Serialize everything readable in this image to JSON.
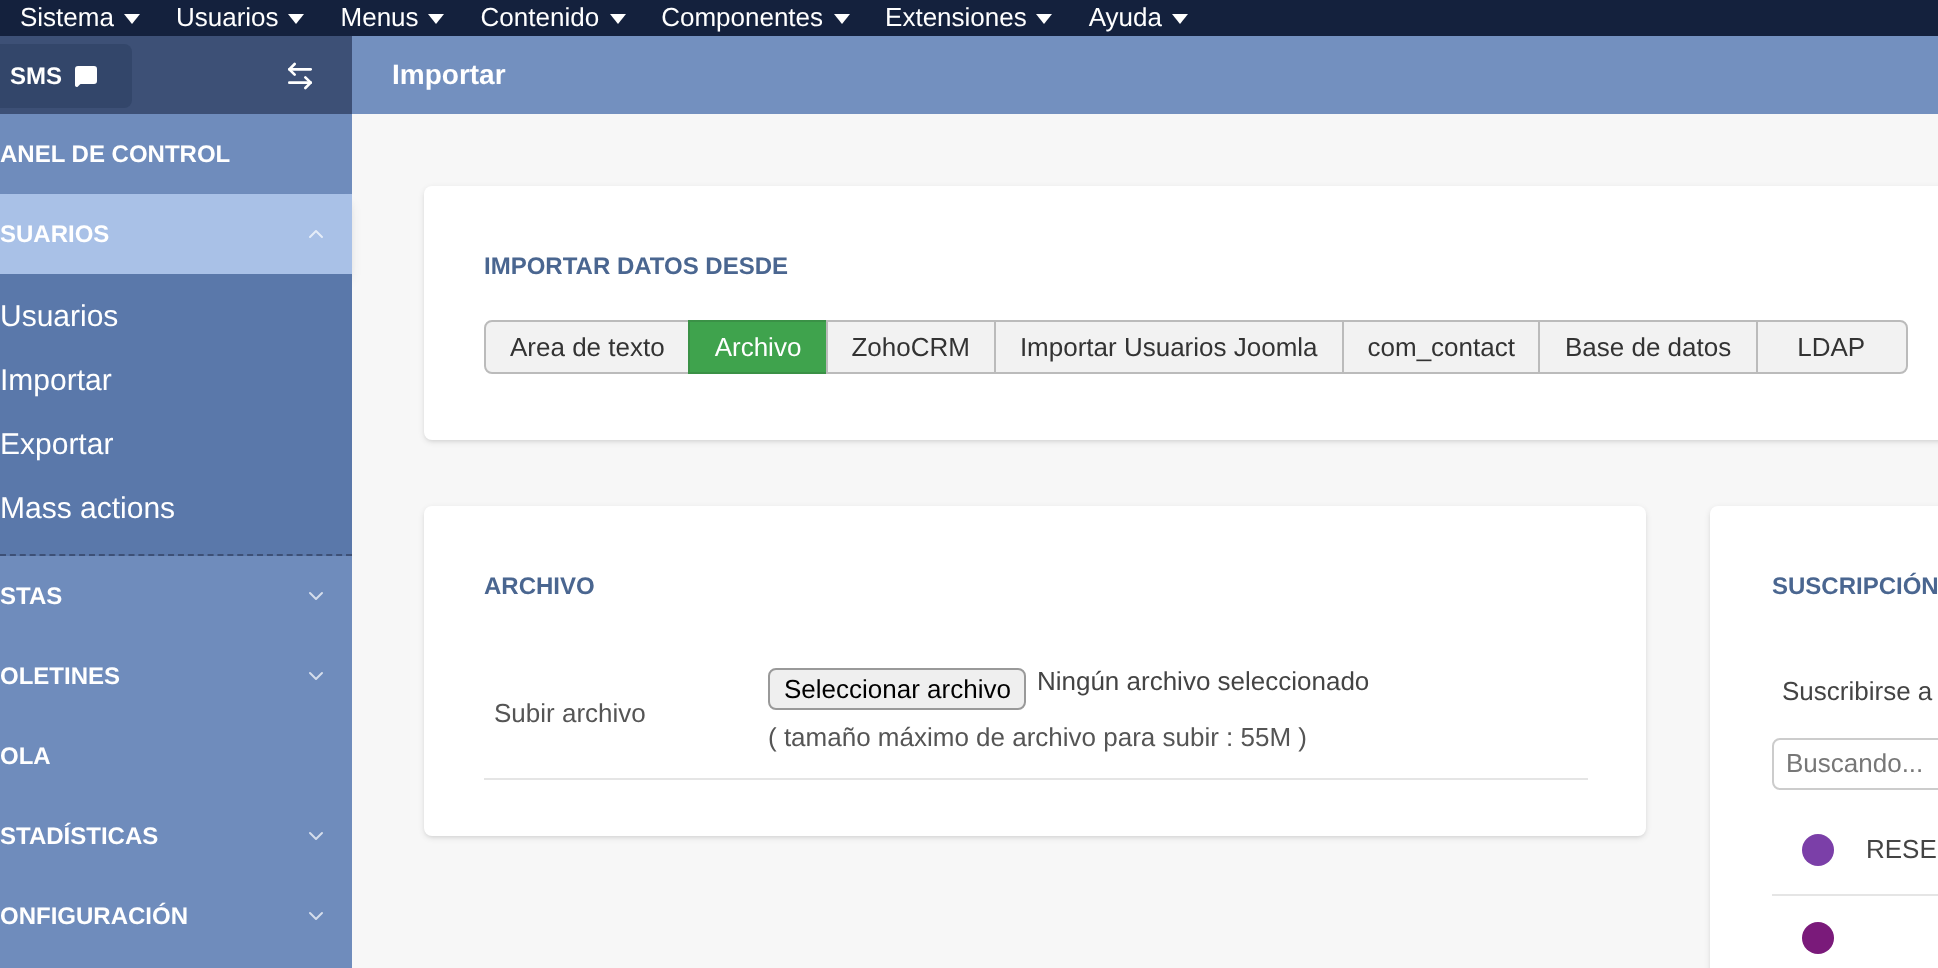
{
  "top_menu": [
    {
      "label": "Sistema"
    },
    {
      "label": "Usuarios"
    },
    {
      "label": "Menus"
    },
    {
      "label": "Contenido"
    },
    {
      "label": "Componentes"
    },
    {
      "label": "Extensiones"
    },
    {
      "label": "Ayuda"
    }
  ],
  "sidebar": {
    "badge": "SMS",
    "items": [
      {
        "label": "ANEL DE CONTROL",
        "selected": false
      },
      {
        "label": "SUARIOS",
        "selected": true,
        "expanded": true,
        "children": [
          {
            "label": "Usuarios"
          },
          {
            "label": "Importar"
          },
          {
            "label": "Exportar"
          },
          {
            "label": "Mass actions"
          }
        ]
      },
      {
        "label": "STAS",
        "selected": false,
        "expanded": false
      },
      {
        "label": "OLETINES",
        "selected": false,
        "expanded": false
      },
      {
        "label": "OLA",
        "selected": false
      },
      {
        "label": "STADÍSTICAS",
        "selected": false,
        "expanded": false
      },
      {
        "label": "ONFIGURACIÓN",
        "selected": false,
        "expanded": false
      }
    ]
  },
  "page_title": "Importar",
  "import_source": {
    "title": "IMPORTAR DATOS DESDE",
    "tabs": [
      {
        "label": "Area de texto",
        "selected": false
      },
      {
        "label": "Archivo",
        "selected": true
      },
      {
        "label": "ZohoCRM",
        "selected": false
      },
      {
        "label": "Importar Usuarios Joomla",
        "selected": false
      },
      {
        "label": "com_contact",
        "selected": false
      },
      {
        "label": "Base de datos",
        "selected": false
      },
      {
        "label": "LDAP",
        "selected": false
      }
    ]
  },
  "file_card": {
    "title": "ARCHIVO",
    "label": "Subir archivo",
    "button": "Seleccionar archivo",
    "status": "Ningún archivo seleccionado",
    "hint": "( tamaño máximo de archivo para subir : 55M )"
  },
  "subscription_card": {
    "title": "SUSCRIPCIÓN",
    "text": "Suscribirse a",
    "search_placeholder": "Buscando...",
    "lists": [
      {
        "label": "RESE",
        "color": "#7b3fa8"
      },
      {
        "color": "#7a1a7a"
      }
    ]
  }
}
